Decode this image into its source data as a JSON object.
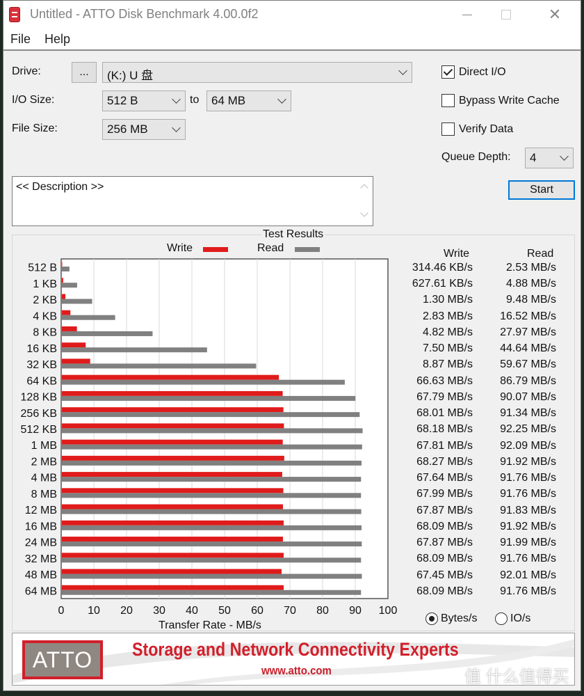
{
  "window": {
    "title": "Untitled - ATTO Disk Benchmark 4.00.0f2",
    "controls": {
      "minimize": "–",
      "maximize": "□",
      "close": "✕"
    }
  },
  "menu": [
    "File",
    "Help"
  ],
  "settings": {
    "drive_label": "Drive:",
    "browse_label": "...",
    "drive_value": "(K:) U 盘",
    "io_size_label": "I/O Size:",
    "io_size_from": "512 B",
    "io_to_label": "to",
    "io_size_to": "64 MB",
    "file_size_label": "File Size:",
    "file_size_value": "256 MB",
    "direct_io": {
      "label": "Direct I/O",
      "checked": true
    },
    "bypass_write_cache": {
      "label": "Bypass Write Cache",
      "checked": false
    },
    "verify_data": {
      "label": "Verify Data",
      "checked": false
    },
    "queue_depth_label": "Queue Depth:",
    "queue_depth_value": "4",
    "start_label": "Start"
  },
  "description": {
    "text": "<< Description >>"
  },
  "results": {
    "title": "Test Results",
    "legend": {
      "write": "Write",
      "read": "Read"
    },
    "column_write": "Write",
    "column_read": "Read",
    "rows": [
      {
        "size": "512 B",
        "write": "314.46 KB/s",
        "read": "2.53 MB/s"
      },
      {
        "size": "1 KB",
        "write": "627.61 KB/s",
        "read": "4.88 MB/s"
      },
      {
        "size": "2 KB",
        "write": "1.30 MB/s",
        "read": "9.48 MB/s"
      },
      {
        "size": "4 KB",
        "write": "2.83 MB/s",
        "read": "16.52 MB/s"
      },
      {
        "size": "8 KB",
        "write": "4.82 MB/s",
        "read": "27.97 MB/s"
      },
      {
        "size": "16 KB",
        "write": "7.50 MB/s",
        "read": "44.64 MB/s"
      },
      {
        "size": "32 KB",
        "write": "8.87 MB/s",
        "read": "59.67 MB/s"
      },
      {
        "size": "64 KB",
        "write": "66.63 MB/s",
        "read": "86.79 MB/s"
      },
      {
        "size": "128 KB",
        "write": "67.79 MB/s",
        "read": "90.07 MB/s"
      },
      {
        "size": "256 KB",
        "write": "68.01 MB/s",
        "read": "91.34 MB/s"
      },
      {
        "size": "512 KB",
        "write": "68.18 MB/s",
        "read": "92.25 MB/s"
      },
      {
        "size": "1 MB",
        "write": "67.81 MB/s",
        "read": "92.09 MB/s"
      },
      {
        "size": "2 MB",
        "write": "68.27 MB/s",
        "read": "91.92 MB/s"
      },
      {
        "size": "4 MB",
        "write": "67.64 MB/s",
        "read": "91.76 MB/s"
      },
      {
        "size": "8 MB",
        "write": "67.99 MB/s",
        "read": "91.76 MB/s"
      },
      {
        "size": "12 MB",
        "write": "67.87 MB/s",
        "read": "91.83 MB/s"
      },
      {
        "size": "16 MB",
        "write": "68.09 MB/s",
        "read": "91.92 MB/s"
      },
      {
        "size": "24 MB",
        "write": "67.87 MB/s",
        "read": "91.99 MB/s"
      },
      {
        "size": "32 MB",
        "write": "68.09 MB/s",
        "read": "91.76 MB/s"
      },
      {
        "size": "48 MB",
        "write": "67.45 MB/s",
        "read": "92.01 MB/s"
      },
      {
        "size": "64 MB",
        "write": "68.09 MB/s",
        "read": "91.76 MB/s"
      }
    ],
    "units": {
      "bytes_label": "Bytes/s",
      "bytes_selected": true,
      "io_label": "IO/s",
      "io_selected": false
    }
  },
  "chart_data": {
    "type": "bar",
    "orientation": "horizontal",
    "title": "Test Results",
    "xlabel": "Transfer Rate - MB/s",
    "ylabel": "",
    "xlim": [
      0,
      100
    ],
    "xticks": [
      0,
      10,
      20,
      30,
      40,
      50,
      60,
      70,
      80,
      90,
      100
    ],
    "grid": true,
    "legend_position": "top-center",
    "categories": [
      "512 B",
      "1 KB",
      "2 KB",
      "4 KB",
      "8 KB",
      "16 KB",
      "32 KB",
      "64 KB",
      "128 KB",
      "256 KB",
      "512 KB",
      "1 MB",
      "2 MB",
      "4 MB",
      "8 MB",
      "12 MB",
      "16 MB",
      "24 MB",
      "32 MB",
      "48 MB",
      "64 MB"
    ],
    "series": [
      {
        "name": "Write",
        "color": "#e01b1b",
        "values": [
          0.31,
          0.61,
          1.3,
          2.83,
          4.82,
          7.5,
          8.87,
          66.63,
          67.79,
          68.01,
          68.18,
          67.81,
          68.27,
          67.64,
          67.99,
          67.87,
          68.09,
          67.87,
          68.09,
          67.45,
          68.09
        ]
      },
      {
        "name": "Read",
        "color": "#808080",
        "values": [
          2.53,
          4.88,
          9.48,
          16.52,
          27.97,
          44.64,
          59.67,
          86.79,
          90.07,
          91.34,
          92.25,
          92.09,
          91.92,
          91.76,
          91.76,
          91.83,
          91.92,
          91.99,
          91.76,
          92.01,
          91.76
        ]
      }
    ]
  },
  "banner": {
    "logo": "ATTO",
    "tagline": "Storage and Network Connectivity Experts",
    "url": "www.atto.com"
  },
  "watermark": "值 什么值得买"
}
